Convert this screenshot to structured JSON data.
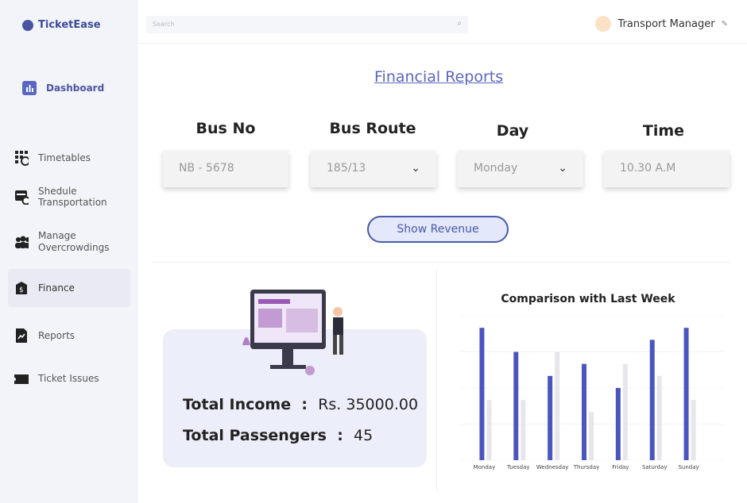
{
  "app": {
    "name": "TicketEase"
  },
  "search": {
    "placeholder": "Search"
  },
  "user": {
    "name": "Transport Manager"
  },
  "sidebar": {
    "items": [
      {
        "label": "Dashboard",
        "icon": "bar-chart-icon"
      },
      {
        "label": "Timetables",
        "icon": "calendar-clock-icon"
      },
      {
        "label": "Shedule Transportation",
        "icon": "schedule-icon"
      },
      {
        "label": "Manage Overcrowdings",
        "icon": "people-icon"
      },
      {
        "label": "Finance",
        "icon": "finance-icon",
        "active": true
      },
      {
        "label": "Reports",
        "icon": "report-icon"
      },
      {
        "label": "Ticket Issues",
        "icon": "ticket-icon"
      }
    ]
  },
  "page": {
    "title": "Financial Reports"
  },
  "filters": {
    "bus_no": {
      "label": "Bus No",
      "placeholder": "NB - 5678"
    },
    "bus_route": {
      "label": "Bus Route",
      "value": "185/13"
    },
    "day": {
      "label": "Day",
      "value": "Monday"
    },
    "time": {
      "label": "Time",
      "placeholder": "10.30 A.M"
    }
  },
  "show_revenue": "Show Revenue",
  "summary": {
    "income_label": "Total Income",
    "income_value": "Rs. 35000.00",
    "passengers_label": "Total Passengers",
    "passengers_value": "45",
    "sep": ":"
  },
  "colors": {
    "accent": "#4a55c0",
    "previous": "#e6e6ec",
    "card": "#eceef9"
  },
  "chart_data": {
    "type": "bar",
    "title": "Comparison with Last Week",
    "categories": [
      "Monday",
      "Tuesday",
      "Wednesday",
      "Thursday",
      "Friday",
      "Saturday",
      "Sunday"
    ],
    "series": [
      {
        "values": [
          11,
          9,
          7,
          8,
          6,
          10,
          11
        ],
        "color": "#4a55c0"
      },
      {
        "values": [
          5,
          5,
          9,
          4,
          8,
          7,
          5
        ],
        "color": "#e6e6ec"
      }
    ],
    "ylim": [
      0,
      12
    ],
    "grid": true,
    "xlabel": "",
    "ylabel": ""
  }
}
